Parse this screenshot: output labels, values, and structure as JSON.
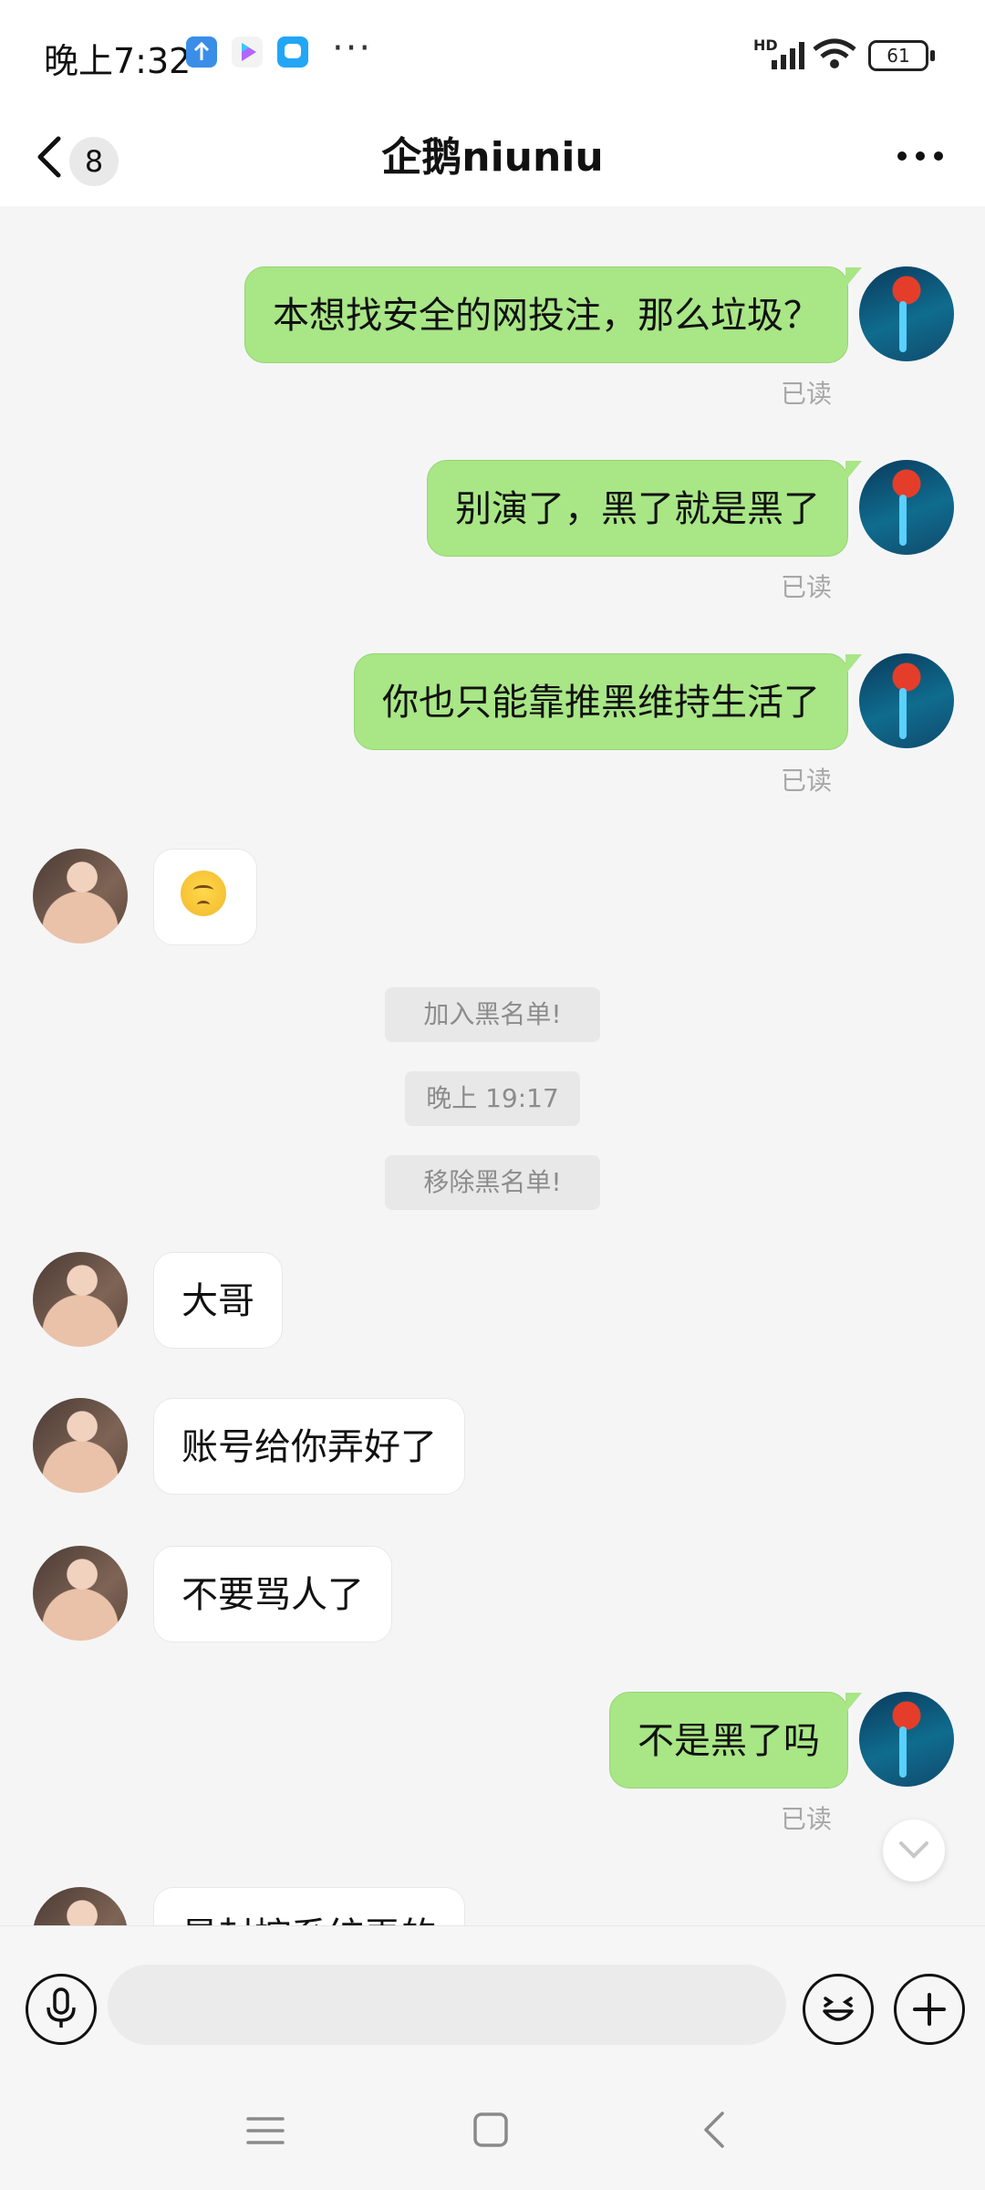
{
  "status_bar": {
    "time": "晚上7:32",
    "overflow": "···",
    "hd": "HD",
    "battery": "61",
    "app_icons": [
      "upload-app-icon",
      "video-app-icon",
      "chat-app-icon"
    ]
  },
  "header": {
    "unread_count": "8",
    "title": "企鹅niuniu"
  },
  "messages": [
    {
      "sender": "me",
      "text": "本想找安全的网投注，那么垃圾？",
      "status": "已读"
    },
    {
      "sender": "me",
      "text": "别演了，黑了就是黑了",
      "status": "已读"
    },
    {
      "sender": "me",
      "text": "你也只能靠推黑维持生活了",
      "status": "已读"
    },
    {
      "sender": "her",
      "emoji": "hushed-face"
    },
    {
      "system": "加入黑名单!"
    },
    {
      "system": "晚上 19:17"
    },
    {
      "system": "移除黑名单!"
    },
    {
      "sender": "her",
      "text": "大哥"
    },
    {
      "sender": "her",
      "text": "账号给你弄好了"
    },
    {
      "sender": "her",
      "text": "不要骂人了"
    },
    {
      "sender": "me",
      "text": "不是黑了吗",
      "status": "已读"
    },
    {
      "sender": "her",
      "text": "是封控系统弄的"
    }
  ],
  "input": {
    "value": "",
    "placeholder": ""
  },
  "colors": {
    "my_bubble": "#a8e686",
    "her_bubble": "#ffffff",
    "background": "#f5f5f6",
    "system_msg": "#e8e8e9"
  }
}
